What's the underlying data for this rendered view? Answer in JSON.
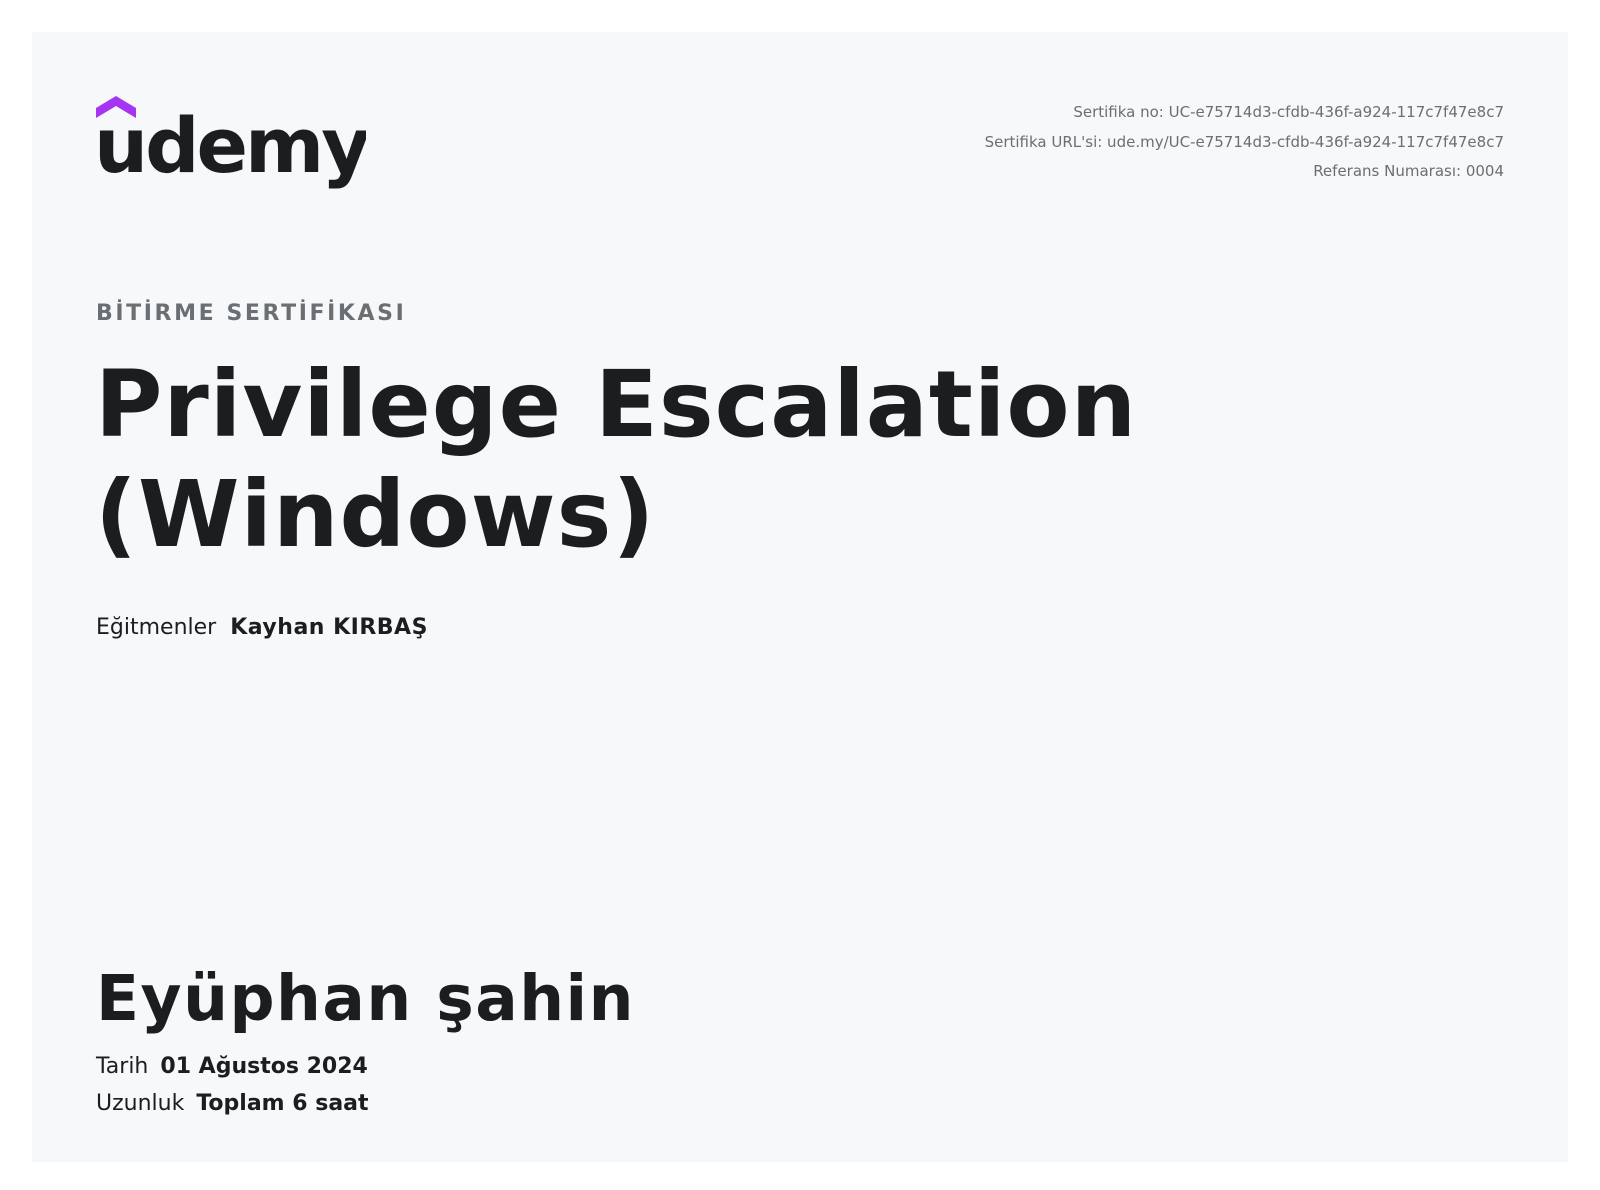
{
  "logo": {
    "text": "udemy",
    "accent_color": "#a435f0",
    "mark_color": "#1c1d1f"
  },
  "meta": {
    "certificate_no": "Sertifika no: UC-e75714d3-cfdb-436f-a924-117c7f47e8c7",
    "certificate_url": "Sertifika URL'si: ude.my/UC-e75714d3-cfdb-436f-a924-117c7f47e8c7",
    "reference_no": "Referans Numarası: 0004"
  },
  "eyebrow": "BİTİRME SERTİFİKASI",
  "course": {
    "title_line1": "Privilege Escalation",
    "title_line2": "(Windows)"
  },
  "instructors": {
    "label": "Eğitmenler",
    "value": "Kayhan KIRBAŞ"
  },
  "recipient": "Eyüphan şahin",
  "details": {
    "date_label": "Tarih",
    "date_value": "01 Ağustos 2024",
    "length_label": "Uzunluk",
    "length_value": "Toplam 6 saat"
  },
  "colors": {
    "background": "#f7f8fa",
    "text": "#1c1d1f",
    "muted": "#6a6f73",
    "brand": "#a435f0"
  }
}
